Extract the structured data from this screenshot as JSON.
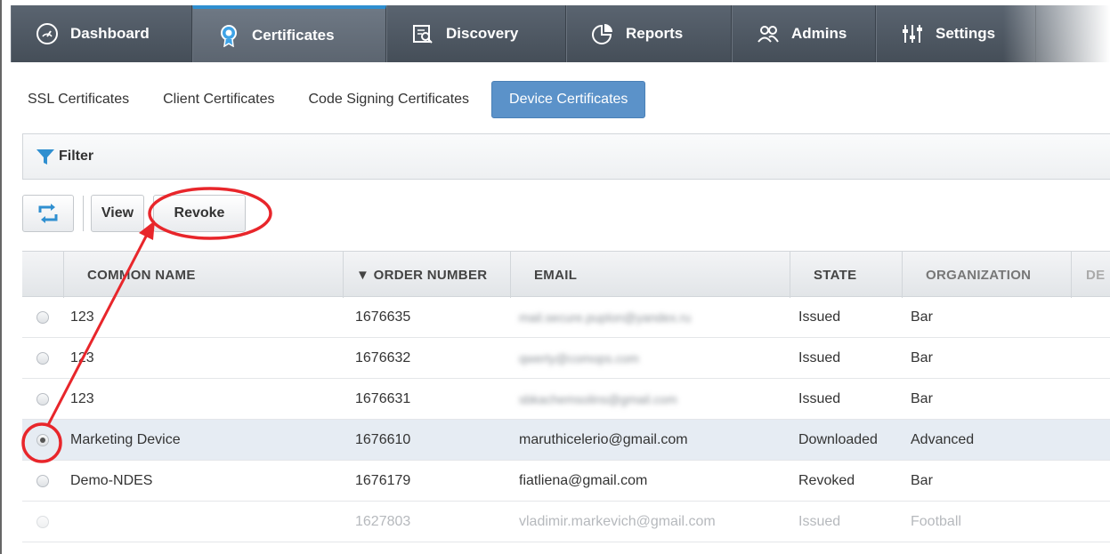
{
  "nav": {
    "tabs": [
      {
        "label": "Dashboard",
        "icon": "gauge-icon"
      },
      {
        "label": "Certificates",
        "icon": "certificate-icon"
      },
      {
        "label": "Discovery",
        "icon": "discovery-icon"
      },
      {
        "label": "Reports",
        "icon": "reports-icon"
      },
      {
        "label": "Admins",
        "icon": "admins-icon"
      },
      {
        "label": "Settings",
        "icon": "settings-icon"
      }
    ],
    "active": "Certificates"
  },
  "subtabs": {
    "ssl": "SSL Certificates",
    "client": "Client Certificates",
    "code": "Code Signing Certificates",
    "device": "Device Certificates"
  },
  "filter": {
    "label": "Filter"
  },
  "toolbar": {
    "view_label": "View",
    "revoke_label": "Revoke"
  },
  "table": {
    "headers": {
      "common_name": "COMMON NAME",
      "order_number": "▼ ORDER NUMBER",
      "email": "EMAIL",
      "state": "STATE",
      "organization": "ORGANIZATION",
      "cut": "DE"
    },
    "rows": [
      {
        "name": "123",
        "order": "1676635",
        "email": "mail.secure.puplon@yandex.ru",
        "state": "Issued",
        "org": "Bar"
      },
      {
        "name": "123",
        "order": "1676632",
        "email": "qwerty@comops.com",
        "state": "Issued",
        "org": "Bar"
      },
      {
        "name": "123",
        "order": "1676631",
        "email": "sbkachemsolins@gmail.com",
        "state": "Issued",
        "org": "Bar"
      },
      {
        "name": "Marketing Device",
        "order": "1676610",
        "email": "maruthicelerio@gmail.com",
        "state": "Downloaded",
        "org": "Advanced"
      },
      {
        "name": "Demo-NDES",
        "order": "1676179",
        "email": "fiatliena@gmail.com",
        "state": "Revoked",
        "org": "Bar"
      },
      {
        "name": "",
        "order": "1627803",
        "email": "vladimir.markevich@gmail.com",
        "state": "Issued",
        "org": "Football"
      }
    ]
  },
  "colors": {
    "nav_bg": "#4f5863",
    "active_subtab": "#5b92c9",
    "annotation": "#e8262b",
    "selected_row": "#e6ecf3"
  }
}
